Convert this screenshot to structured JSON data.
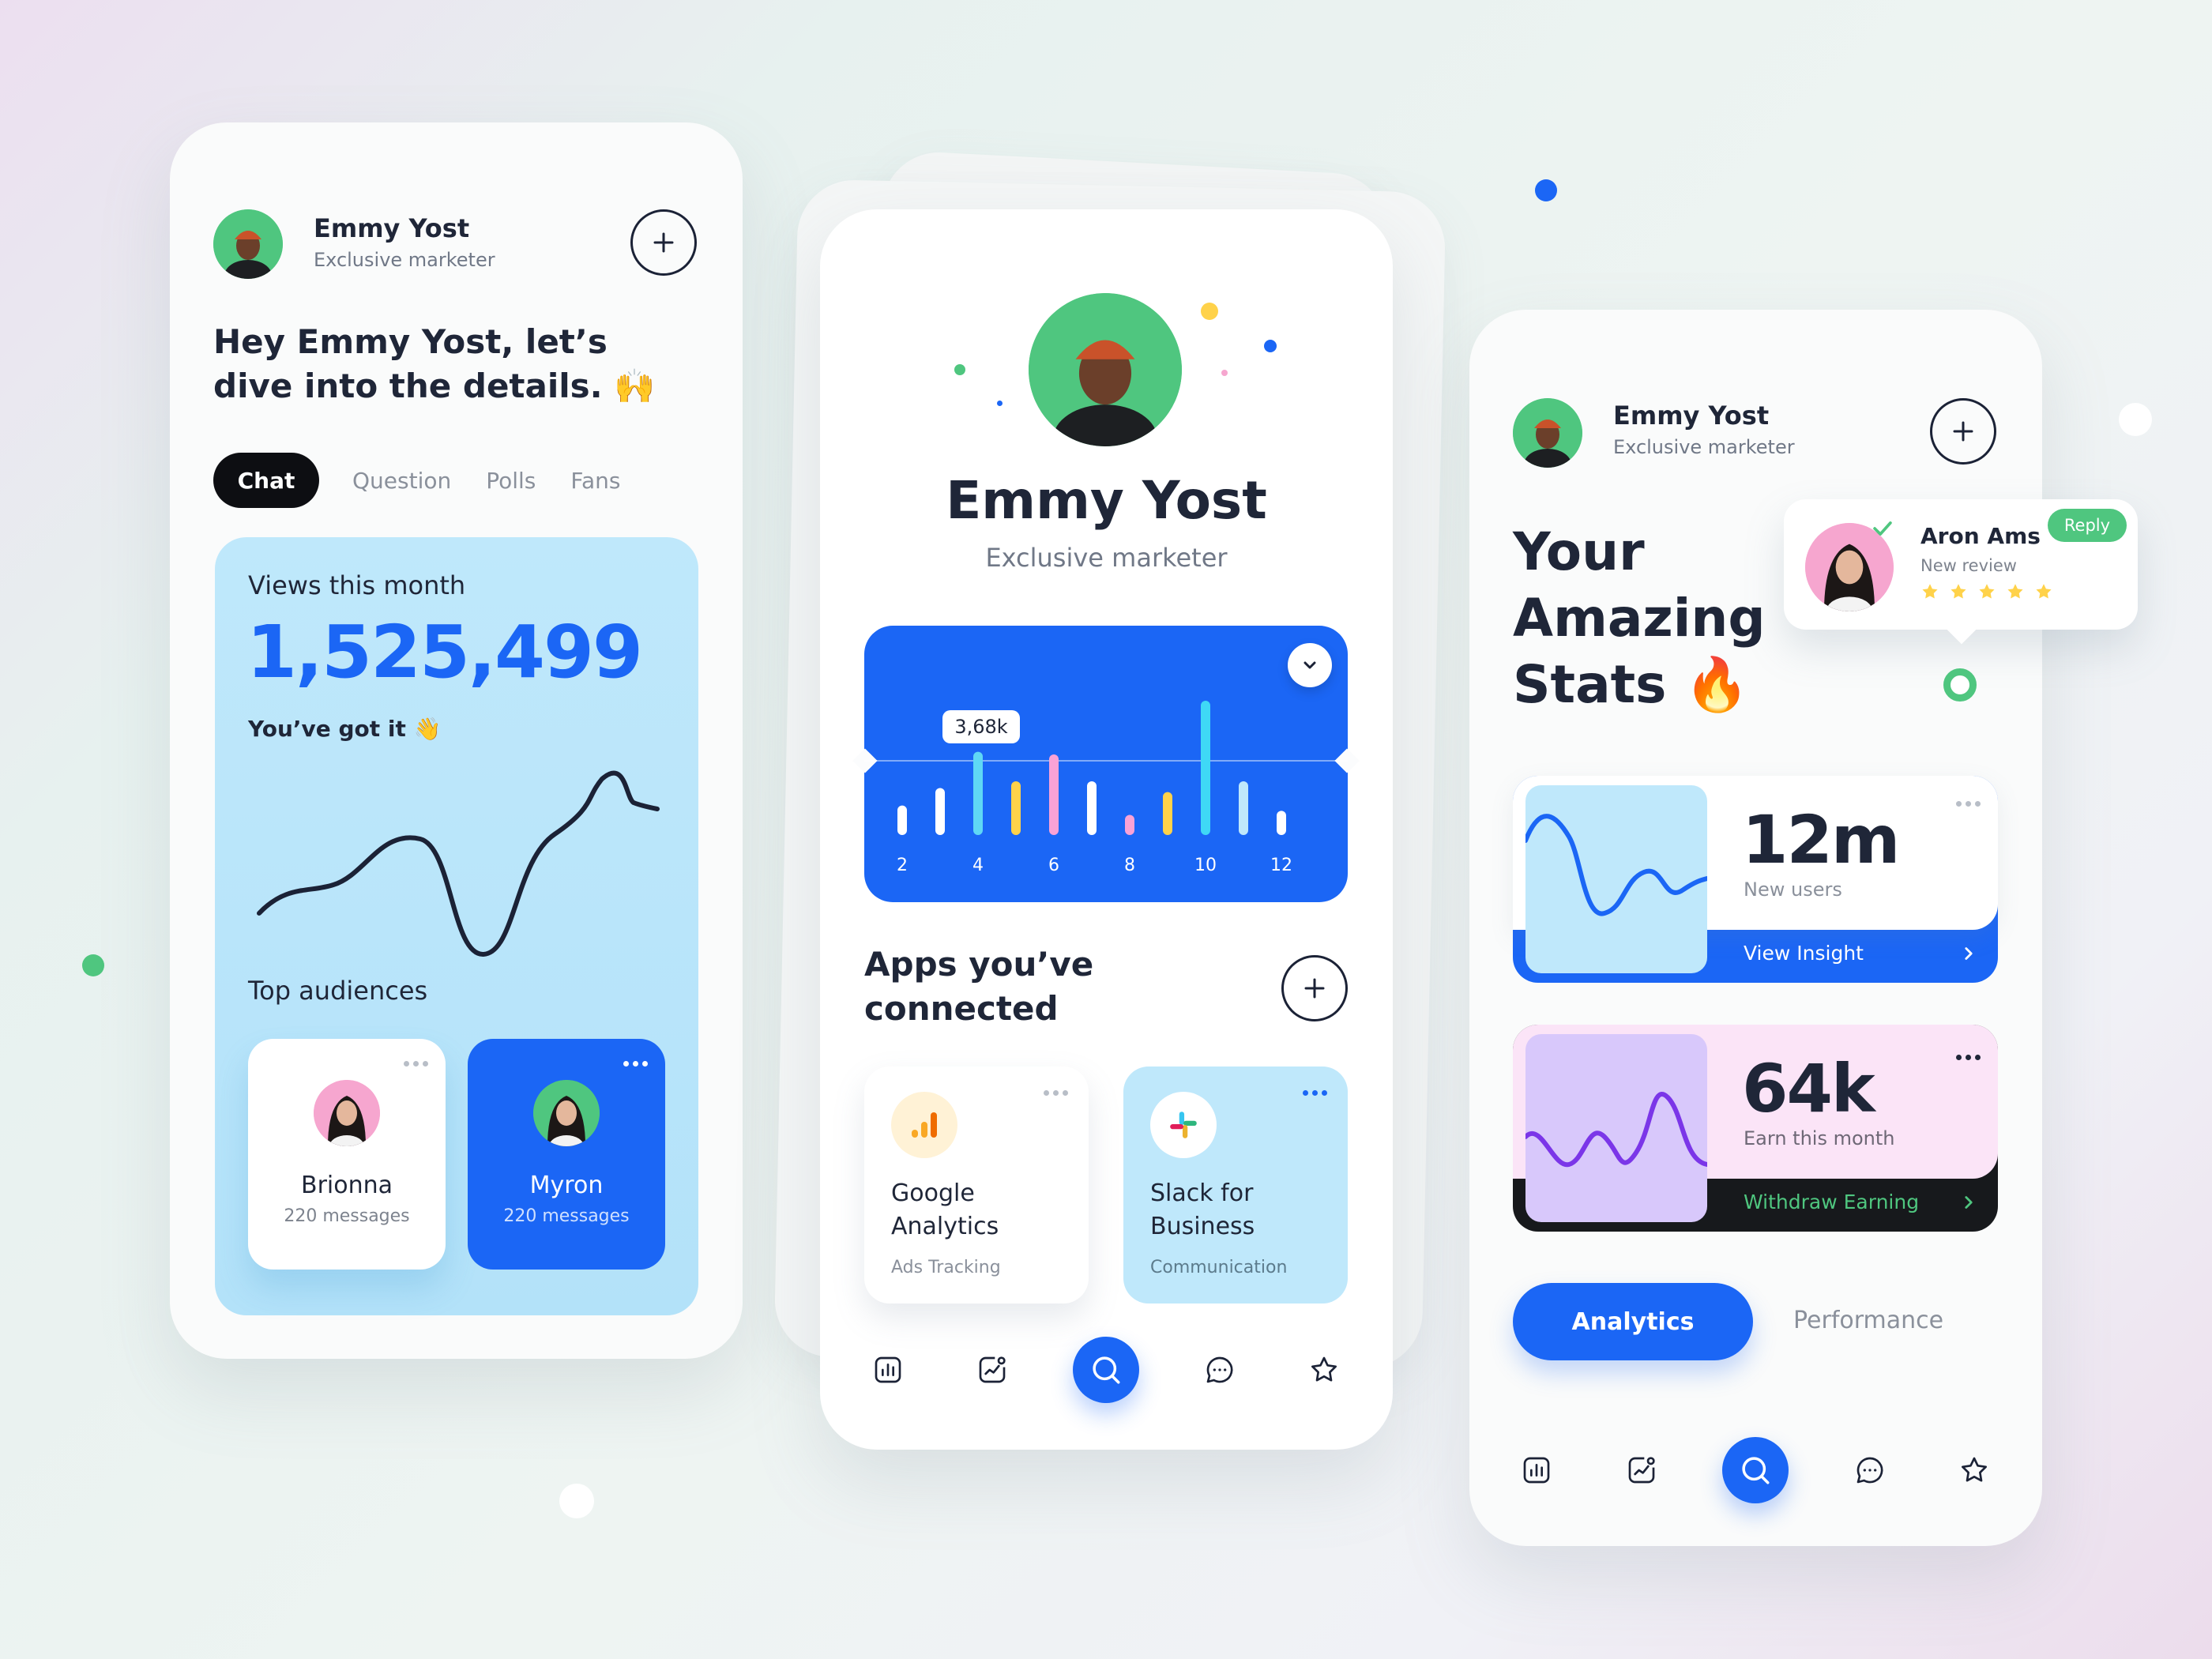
{
  "colors": {
    "blue": "#1b66f5",
    "green": "#4fc67f",
    "light_blue": "#bfe8fb",
    "pink": "#fbe4f7",
    "purple": "#d8c8fb",
    "dark": "#1b2236"
  },
  "left_card": {
    "profile": {
      "name": "Emmy Yost",
      "role": "Exclusive marketer"
    },
    "greeting_line1": "Hey Emmy Yost, let’s",
    "greeting_line2": "dive into the details. 🙌",
    "tabs": [
      "Chat",
      "Question",
      "Polls",
      "Fans"
    ],
    "active_tab": "Chat",
    "views_label": "Views this month",
    "views_value": "1,525,499",
    "views_note": "You’ve got it 👋",
    "audiences_title": "Top audiences",
    "audiences": [
      {
        "name": "Brionna",
        "messages": "220 messages"
      },
      {
        "name": "Myron",
        "messages": "220 messages"
      }
    ]
  },
  "center_card": {
    "profile": {
      "name": "Emmy Yost",
      "role": "Exclusive marketer"
    },
    "chart_tooltip": "3,68k",
    "chart_data": {
      "type": "bar",
      "x_tick_labels": [
        "2",
        "4",
        "6",
        "8",
        "10",
        "12"
      ],
      "values": [
        0.22,
        0.35,
        0.62,
        0.4,
        0.6,
        0.4,
        0.15,
        0.32,
        1.0,
        0.4,
        0.18
      ],
      "bar_colors": [
        "#ffffff",
        "#ffffff",
        "#5fd8f5",
        "#ffd24a",
        "#f9a2d6",
        "#ffffff",
        "#f9a2d6",
        "#ffd24a",
        "#3fd8f6",
        "#bfe8fb",
        "#ffffff"
      ]
    },
    "apps_title_line1": "Apps you’ve",
    "apps_title_line2": "connected",
    "apps": [
      {
        "name_line1": "Google",
        "name_line2": "Analytics",
        "category": "Ads Tracking"
      },
      {
        "name_line1": "Slack for",
        "name_line2": "Business",
        "category": "Communication"
      }
    ],
    "nav": [
      "chart-icon",
      "trend-icon",
      "search-icon",
      "chat-icon",
      "star-icon"
    ]
  },
  "right_card": {
    "profile": {
      "name": "Emmy Yost",
      "role": "Exclusive marketer"
    },
    "title_line1": "Your",
    "title_line2": "Amazing",
    "title_line3": "Stats 🔥",
    "review": {
      "name": "Aron Ams",
      "note": "New review",
      "badge": "Reply",
      "stars": 5
    },
    "stat1": {
      "value": "12m",
      "label": "New users",
      "action": "View Insight"
    },
    "stat2": {
      "value": "64k",
      "label": "Earn this month",
      "action": "Withdraw Earning"
    },
    "tabs": [
      "Analytics",
      "Performance"
    ],
    "active_tab": "Analytics",
    "nav": [
      "chart-icon",
      "trend-icon",
      "search-icon",
      "chat-icon",
      "star-icon"
    ]
  }
}
